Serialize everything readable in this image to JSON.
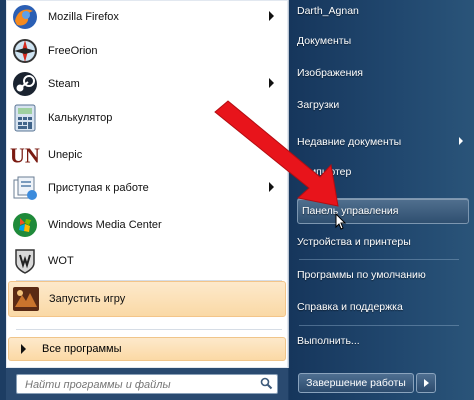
{
  "programs": [
    {
      "label": "Mozilla Firefox",
      "icon": "firefox-icon",
      "has_submenu": true
    },
    {
      "label": "FreeOrion",
      "icon": "freeorion-icon",
      "has_submenu": false
    },
    {
      "label": "Steam",
      "icon": "steam-icon",
      "has_submenu": true
    },
    {
      "label": "Калькулятор",
      "icon": "calculator-icon",
      "has_submenu": false
    },
    {
      "label": "Unepic",
      "icon": "unepic-icon",
      "has_submenu": false
    },
    {
      "label": "Приступая к работе",
      "icon": "getting-started-icon",
      "has_submenu": true
    },
    {
      "label": "Windows Media Center",
      "icon": "media-center-icon",
      "has_submenu": false
    },
    {
      "label": "WOT",
      "icon": "wot-icon",
      "has_submenu": false
    },
    {
      "label": "Запустить игру",
      "icon": "game-launcher-icon",
      "has_submenu": false
    }
  ],
  "all_programs_label": "Все программы",
  "search": {
    "placeholder": "Найти программы и файлы"
  },
  "right_items": [
    {
      "label": "Darth_Agnan",
      "has_submenu": false
    },
    {
      "label": "Документы",
      "has_submenu": false
    },
    {
      "label": "Изображения",
      "has_submenu": false
    },
    {
      "label": "Загрузки",
      "has_submenu": false
    },
    {
      "label": "Недавние документы",
      "has_submenu": true
    },
    {
      "label": "Компьютер",
      "has_submenu": false
    },
    {
      "label": "Панель управления",
      "has_submenu": false,
      "highlighted": true
    },
    {
      "label": "Устройства и принтеры",
      "has_submenu": false
    },
    {
      "label": "Программы по умолчанию",
      "has_submenu": false
    },
    {
      "label": "Справка и поддержка",
      "has_submenu": false
    },
    {
      "label": "Выполнить...",
      "has_submenu": false
    }
  ],
  "shutdown_label": "Завершение работы",
  "colors": {
    "highlight": "#fad9a6",
    "pane_dark": "#1d3d63",
    "arrow": "#e8141b"
  }
}
